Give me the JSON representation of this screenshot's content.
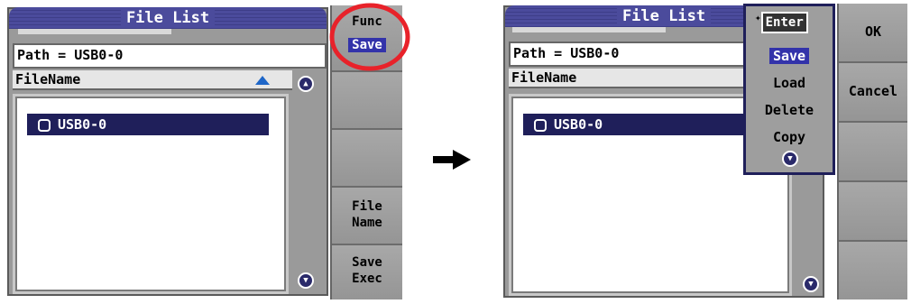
{
  "left": {
    "title": "File List",
    "path": "Path = USB0-0",
    "header": "FileName",
    "row": "USB0-0",
    "softkeys": {
      "func": "Func",
      "save": "Save",
      "file_name": "File\nName",
      "save_exec": "Save\nExec"
    }
  },
  "right": {
    "title": "File List",
    "path": "Path = USB0-0",
    "header": "FileName",
    "row": "USB0-0",
    "popup": {
      "enter": "Enter",
      "items": [
        "Save",
        "Load",
        "Delete",
        "Copy"
      ]
    },
    "softkeys": {
      "ok": "OK",
      "cancel": "Cancel"
    }
  },
  "colors": {
    "highlight_ring": "#e8222a",
    "selection_bg": "#1f1f5a",
    "title_bg": "#4b4b9c"
  }
}
